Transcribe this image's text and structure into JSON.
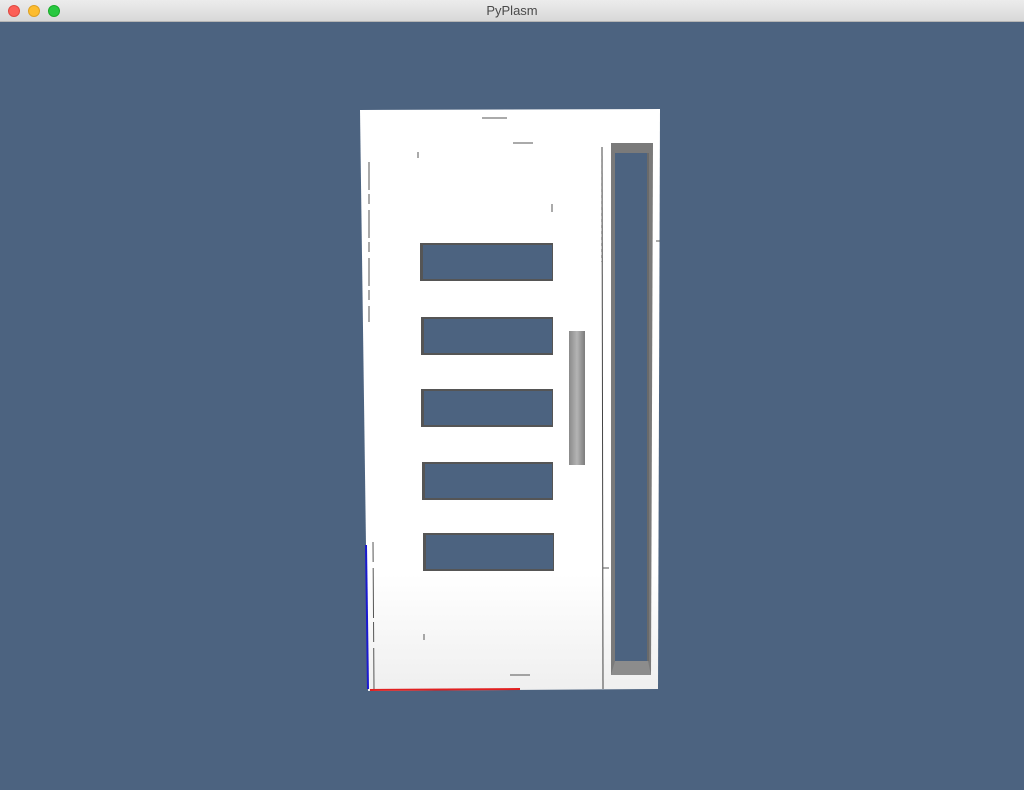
{
  "window": {
    "title": "PyPlasm"
  },
  "colors": {
    "background": "#4c6380",
    "door_panel": "#ffffff",
    "frame_edge": "#7a7a7a",
    "axis_x": "#e02020",
    "axis_z": "#1a1ad0"
  },
  "scene": {
    "object": "door-model",
    "glass_openings": 5,
    "handle": true,
    "side_light": true
  }
}
